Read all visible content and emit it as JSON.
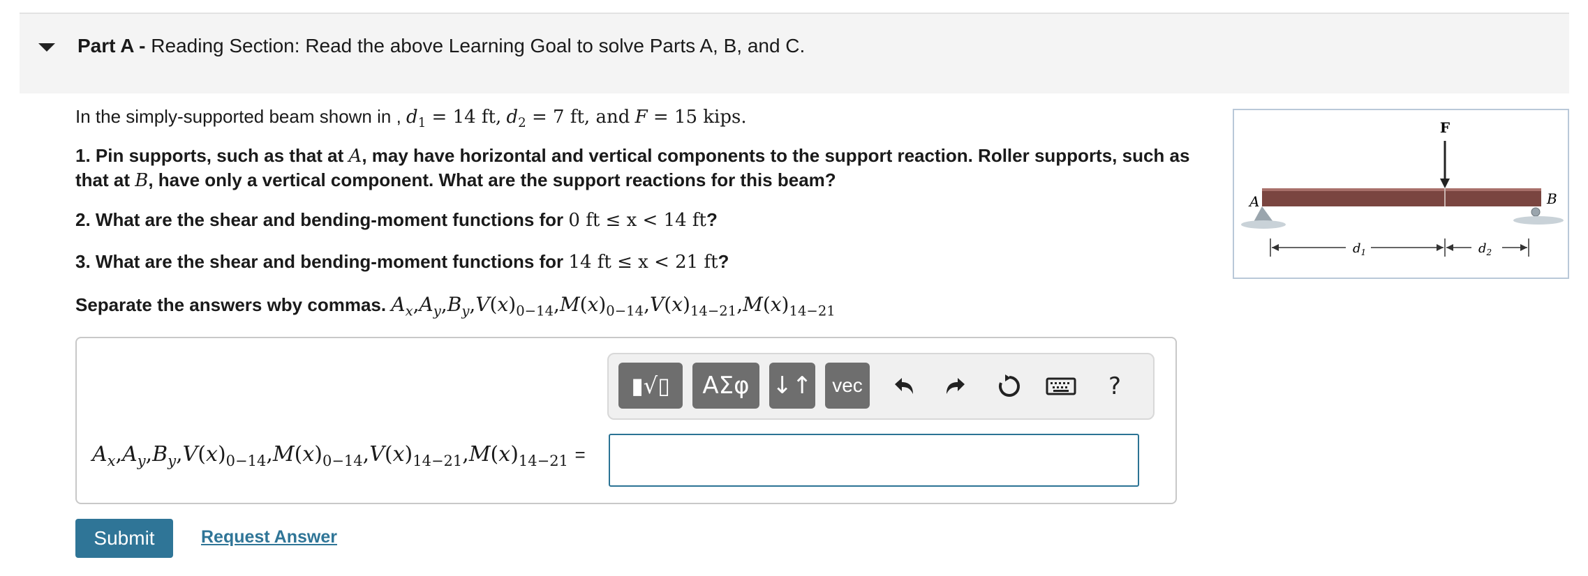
{
  "header": {
    "part_label": "Part A -",
    "title": "Reading Section: Read the above Learning Goal to solve Parts A, B, and C."
  },
  "intro": {
    "prefix": "In the simply-supported beam shown in ,",
    "d1_value": "= 14 ft,",
    "d2_value": "= 7 ft, and",
    "f_value": "= 15 kips."
  },
  "questions": {
    "q1_a": "1. Pin supports, such as that at",
    "q1_b": ", may have horizontal and vertical components to the support reaction. Roller supports, such as",
    "q1_c": "that at",
    "q1_d": ", have only a vertical component. What are the support reactions for this beam?",
    "q2_text": "2. What are the shear and bending-moment functions for",
    "q2_range": "0 ft ≤ x < 14 ft",
    "q3_text": "3. What are the shear and bending-moment functions for",
    "q3_range": "14 ft ≤ x < 21 ft",
    "separate_text": "Separate the answers wby commas."
  },
  "toolbar": {
    "templates_icon": "sqrt-template-icon",
    "greek_label": "ΑΣφ",
    "arrows_label": "↓↑",
    "vec_label": "vec",
    "undo_icon": "undo-icon",
    "redo_icon": "redo-icon",
    "reset_icon": "reset-icon",
    "keyboard_icon": "keyboard-icon",
    "help_label": "?"
  },
  "answer": {
    "equals": "=",
    "value": ""
  },
  "buttons": {
    "submit": "Submit",
    "request": "Request Answer"
  },
  "figure": {
    "force_label": "F",
    "a_label": "A",
    "b_label": "B",
    "d1_label": "d",
    "d1_sub": "1",
    "d2_label": "d",
    "d2_sub": "2",
    "beam_color": "#7a4540"
  },
  "colors": {
    "accent": "#2f7597",
    "header_bg": "#f4f4f4",
    "toolbar_button": "#6e6e6e"
  }
}
